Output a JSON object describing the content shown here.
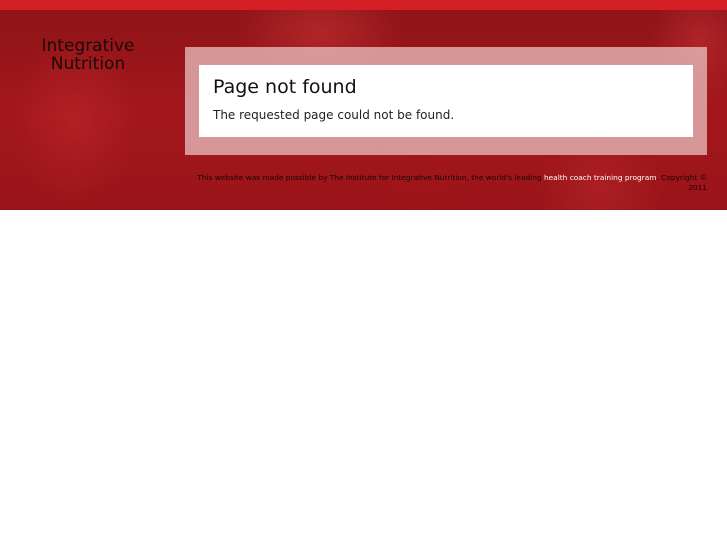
{
  "logo": {
    "line1": "Integrative",
    "line2": "Nutrition"
  },
  "main": {
    "title": "Page not found",
    "message": "The requested page could not be found."
  },
  "footer": {
    "prefix": "This website was made possible by The Institute for Integrative Nutrition, the world's leading ",
    "link_text": "health coach training program",
    "suffix": ". Copyright ©",
    "year": "2011"
  },
  "colors": {
    "top_strip": "#d41f26",
    "banner": "#9a1419",
    "link": "#ffffff"
  }
}
